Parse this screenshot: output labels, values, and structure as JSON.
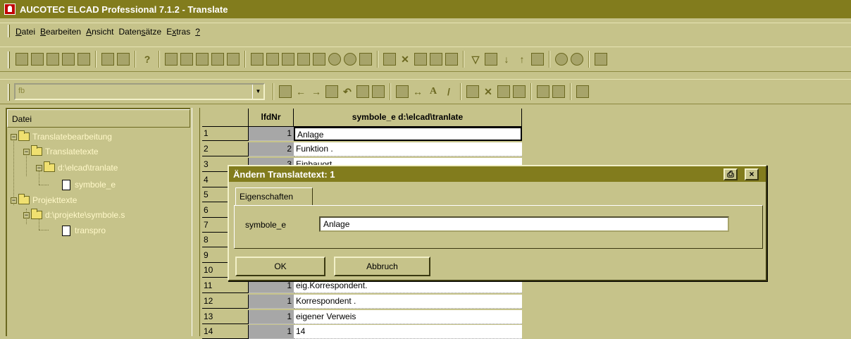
{
  "window": {
    "title": "AUCOTEC ELCAD Professional 7.1.2 - Translate"
  },
  "menu": [
    {
      "pre": "",
      "ul": "D",
      "post": "atei"
    },
    {
      "pre": "",
      "ul": "B",
      "post": "earbeiten"
    },
    {
      "pre": "",
      "ul": "A",
      "post": "nsicht"
    },
    {
      "pre": "Daten",
      "ul": "s",
      "post": "ätze"
    },
    {
      "pre": "E",
      "ul": "x",
      "post": "tras"
    },
    {
      "pre": "",
      "ul": "?",
      "post": ""
    }
  ],
  "toolbar2": {
    "combo_value": "fb",
    "dropdown_glyph": "▼"
  },
  "tree": {
    "header": "Datei",
    "items": [
      {
        "label": "Translatebearbeitung"
      },
      {
        "label": "Translatetexte"
      },
      {
        "label": "d:\\elcad\\tranlate"
      },
      {
        "label": "symbole_e"
      },
      {
        "label": "Projekttexte"
      },
      {
        "label": "d:\\projekte\\symbole.s"
      },
      {
        "label": "transpro"
      }
    ]
  },
  "grid": {
    "col1_header": "lfdNr",
    "col2_header": "symbole_e  d:\\elcad\\tranlate",
    "rows": [
      {
        "n": "1",
        "lfd": "1",
        "text": "Anlage"
      },
      {
        "n": "2",
        "lfd": "2",
        "text": "Funktion        ."
      },
      {
        "n": "3",
        "lfd": "3",
        "text": "Einbauort"
      },
      {
        "n": "4",
        "lfd": "",
        "text": ""
      },
      {
        "n": "5",
        "lfd": "",
        "text": ""
      },
      {
        "n": "6",
        "lfd": "",
        "text": ""
      },
      {
        "n": "7",
        "lfd": "",
        "text": ""
      },
      {
        "n": "8",
        "lfd": "",
        "text": ""
      },
      {
        "n": "9",
        "lfd": "",
        "text": ""
      },
      {
        "n": "10",
        "lfd": "",
        "text": ""
      },
      {
        "n": "11",
        "lfd": "1",
        "text": "eig.Korrespondent."
      },
      {
        "n": "12",
        "lfd": "1",
        "text": "Korrespondent   ."
      },
      {
        "n": "13",
        "lfd": "1",
        "text": "eigener Verweis"
      },
      {
        "n": "14",
        "lfd": "1",
        "text": "14"
      }
    ]
  },
  "dialog": {
    "title": "Ändern Translatetext: 1",
    "tab": "Eigenschaften",
    "field_label": "symbole_e",
    "field_value": "Anlage",
    "ok_label": "OK",
    "cancel_label": "Abbruch",
    "close_glyph": "×",
    "print_glyph": "⎙"
  }
}
